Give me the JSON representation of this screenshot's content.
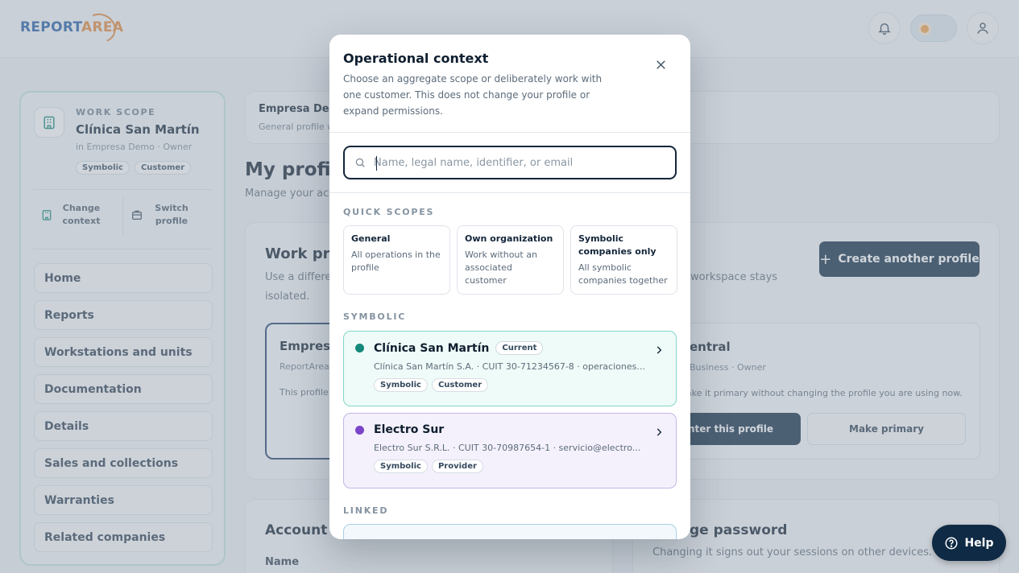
{
  "app": {
    "logo_part1": "REPORT",
    "logo_part2": "AREA"
  },
  "topbar": {
    "notifications_icon": "bell-icon",
    "theme_icon": "sun-icon",
    "account_icon": "user-icon"
  },
  "sidebar": {
    "scope_label": "WORK SCOPE",
    "scope_name": "Clínica San Martín",
    "scope_sub": "in Empresa Demo · Owner",
    "tags": [
      "Symbolic",
      "Customer"
    ],
    "change_context": "Change context",
    "switch_profile": "Switch profile",
    "items": [
      {
        "label": "Home"
      },
      {
        "label": "Reports"
      },
      {
        "label": "Workstations and units"
      },
      {
        "label": "Documentation"
      },
      {
        "label": "Details"
      },
      {
        "label": "Sales and collections"
      },
      {
        "label": "Warranties"
      },
      {
        "label": "Related companies"
      }
    ]
  },
  "background": {
    "company_title": "Empresa Dem",
    "company_sub": "General profile w",
    "page_title": "My profile",
    "page_sub": "Manage your acc",
    "work_title": "Work prof",
    "work_desc_1": "Use a differe",
    "work_desc_2": "isolated.",
    "work_desc_tail": "workspace stays",
    "create_button": "Create another profile",
    "profile_a_title": "Empresa",
    "profile_a_sub": "ReportArea",
    "profile_a_text": "This profile",
    "profile_b_title": "entral",
    "profile_b_sub": "Business · Owner",
    "profile_b_text": "ake it primary without changing the profile you are using now.",
    "enter_button": "nter this profile",
    "make_primary_button": "Make primary",
    "account_title": "Account d",
    "account_name_label": "Name",
    "password_title": "ge password",
    "password_desc": "Changing it signs out your sessions on other devices.",
    "help_button": "Help"
  },
  "modal": {
    "title": "Operational context",
    "description": "Choose an aggregate scope or deliberately work with one customer. This does not change your profile or expand permissions.",
    "search": {
      "placeholder": "Name, legal name, identifier, or email",
      "value": ""
    },
    "quick_scopes_label": "QUICK SCOPES",
    "quick_scopes": [
      {
        "title": "General",
        "desc": "All operations in the profile"
      },
      {
        "title": "Own organization",
        "desc": "Work without an associated customer"
      },
      {
        "title": "Symbolic companies only",
        "desc": "All symbolic companies together"
      }
    ],
    "symbolic_label": "SYMBOLIC",
    "customers": [
      {
        "name": "Clínica San Martín",
        "badge": "Current",
        "detail": "Clínica San Martín S.A. · CUIT 30-71234567-8 · operaciones...",
        "tags": [
          "Symbolic",
          "Customer"
        ],
        "color": "#14897a"
      },
      {
        "name": "Electro Sur",
        "detail": "Electro Sur S.R.L. · CUIT 30-70987654-1 · servicio@electro...",
        "tags": [
          "Symbolic",
          "Provider"
        ],
        "color": "#7b45c9"
      }
    ],
    "linked_label": "LINKED"
  }
}
